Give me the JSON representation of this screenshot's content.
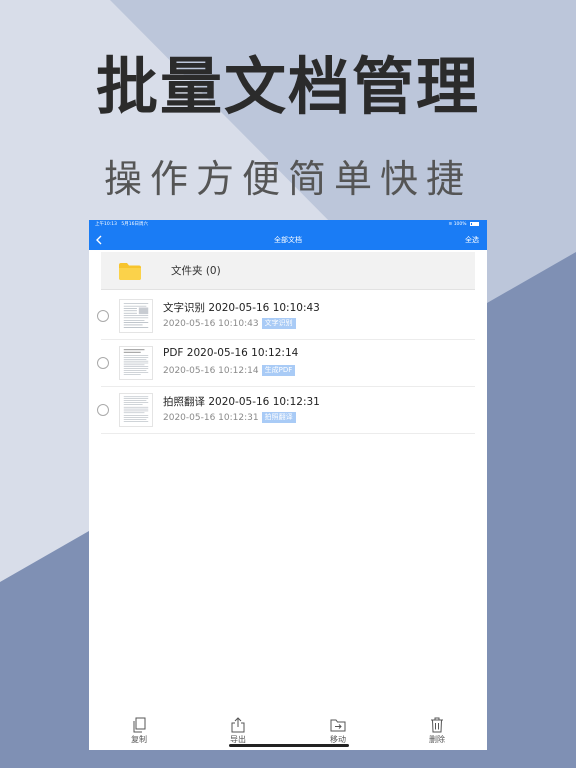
{
  "headline": "批量文档管理",
  "subline": "操作方便简单快捷",
  "status_bar": {
    "time": "上午10:13",
    "date": "5月16日周六",
    "battery": "100%"
  },
  "navbar": {
    "title": "全部文档",
    "select_all": "全选"
  },
  "folder": {
    "label": "文件夹 (0)",
    "icon": "folder-icon"
  },
  "documents": [
    {
      "title": "文字识别 2020-05-16 10:10:43",
      "date": "2020-05-16 10:10:43",
      "tag": "文字识别"
    },
    {
      "title": "PDF 2020-05-16 10:12:14",
      "date": "2020-05-16 10:12:14",
      "tag": "生成PDF"
    },
    {
      "title": "拍照翻译 2020-05-16 10:12:31",
      "date": "2020-05-16 10:12:31",
      "tag": "拍照翻译"
    }
  ],
  "toolbar": {
    "copy": "复制",
    "export": "导出",
    "move": "移动",
    "delete": "删除"
  },
  "colors": {
    "accent": "#1a7cf5",
    "tag": "#a9cbf6",
    "folder": "#f7c42d",
    "bg_light": "#d8dde9",
    "bg_mid": "#bcc6da",
    "bg_dark": "#7f90b4"
  }
}
